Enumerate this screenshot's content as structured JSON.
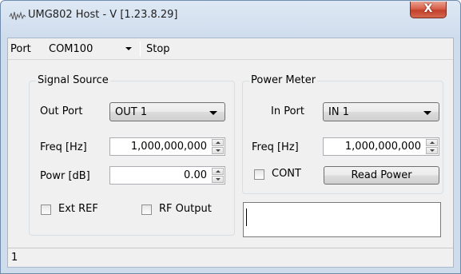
{
  "window": {
    "title": "UMG802 Host - V [1.23.8.29]",
    "close_glyph": "X"
  },
  "toolbar": {
    "port_label": "Port",
    "port_value": "COM100",
    "stop_label": "Stop"
  },
  "signal_source": {
    "title": "Signal Source",
    "out_port_label": "Out Port",
    "out_port_value": "OUT 1",
    "freq_label": "Freq [Hz]",
    "freq_value": "1,000,000,000",
    "powr_label": "Powr [dB]",
    "powr_value": "0.00",
    "ext_ref_label": "Ext REF",
    "rf_output_label": "RF Output"
  },
  "power_meter": {
    "title": "Power Meter",
    "in_port_label": "In Port",
    "in_port_value": "IN 1",
    "freq_label": "Freq [Hz]",
    "freq_value": "1,000,000,000",
    "cont_label": "CONT",
    "read_power_label": "Read Power"
  },
  "status": {
    "text": "1"
  },
  "icons": {
    "app": "waveform-icon",
    "close": "close-icon",
    "dropdown": "chevron-down-icon",
    "spin": "spin-arrows-icon"
  },
  "colors": {
    "titlebar": "#cfdcec",
    "client": "#f0f0f0",
    "close_button": "#c2412b",
    "group_border": "#d5dfe5"
  }
}
